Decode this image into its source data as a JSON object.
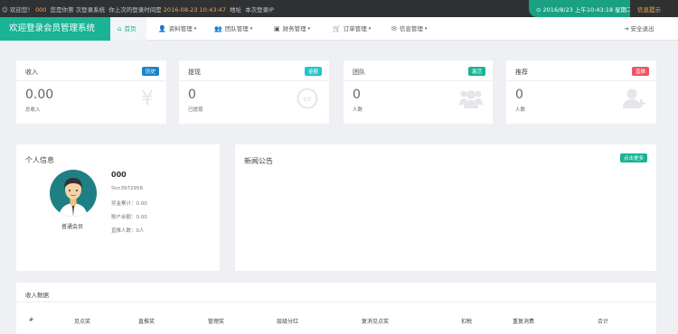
{
  "topbar": {
    "prefix": "欢迎您！",
    "user": "000",
    "mid": "您是你第",
    "visit": "次登录系统",
    "last_label": "你上次的登录时间是",
    "last_time": "2016-08-23 10:43:47",
    "ip_label": "地址",
    "ip_text": "本次登录IP",
    "clock": "2016/8/23 上午10:43:18 星期二",
    "messages": "信息提示"
  },
  "navbar": {
    "brand": "欢迎登录会员管理系统",
    "items": [
      {
        "label": "首页",
        "icon": "home-icon",
        "glyph": "⌂",
        "caret": ""
      },
      {
        "label": "资料管理",
        "icon": "user-icon",
        "glyph": "👤",
        "caret": "▾"
      },
      {
        "label": "团队管理",
        "icon": "users-icon",
        "glyph": "👥",
        "caret": "▾"
      },
      {
        "label": "财务管理",
        "icon": "money-icon",
        "glyph": "▣",
        "caret": "▾"
      },
      {
        "label": "订单管理",
        "icon": "cart-icon",
        "glyph": "🛒",
        "caret": "▾"
      },
      {
        "label": "信息管理",
        "icon": "envelope-icon",
        "glyph": "✉",
        "caret": "▾"
      }
    ],
    "logout": "安全退出"
  },
  "stats": [
    {
      "title": "收入",
      "badge": "历史",
      "badge_color": "#1c84c6",
      "value": "0.00",
      "sub": "总收入",
      "icon": "yen-icon",
      "glyph": "¥"
    },
    {
      "title": "提现",
      "badge": "金额",
      "badge_color": "#23c6c8",
      "value": "0",
      "sub": "已提现",
      "icon": "cc-icon",
      "glyph": "Ⓒ"
    },
    {
      "title": "团队",
      "badge": "激活",
      "badge_color": "#1ab394",
      "value": "0",
      "sub": "人数",
      "icon": "group-icon",
      "glyph": "👥"
    },
    {
      "title": "推荐",
      "badge": "直推",
      "badge_color": "#ed5565",
      "value": "0",
      "sub": "人数",
      "icon": "user-plus-icon",
      "glyph": "👤"
    }
  ],
  "profile": {
    "title": "个人信息",
    "name": "000",
    "id": "cn3972956",
    "bonus": "奖金累计：0.00",
    "balance": "账户余额：0.00",
    "direct": "直推人数：0人",
    "role": "普通会员"
  },
  "news": {
    "title": "新闻公告",
    "more": "点击更多"
  },
  "income": {
    "title": "收入数据",
    "headers": [
      "#",
      "见点奖",
      "直推奖",
      "管理奖",
      "层级分红",
      "复消见点奖",
      "扣税",
      "重复消费",
      "合计"
    ]
  }
}
